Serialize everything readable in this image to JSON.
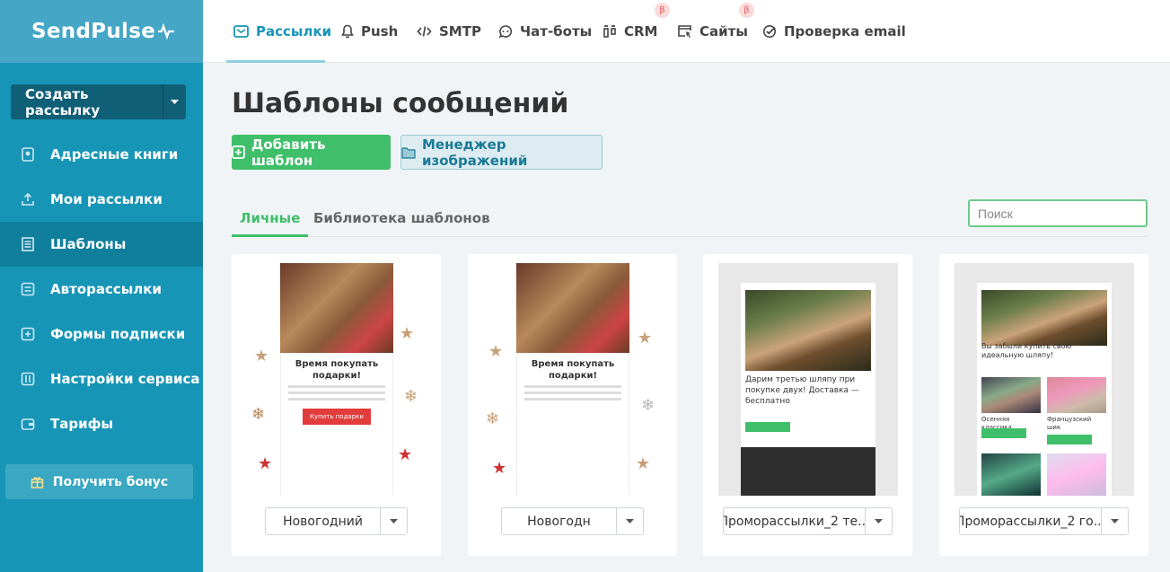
{
  "brand": {
    "name": "SendPulse"
  },
  "sidebar": {
    "create_label": "Создать рассылку",
    "items": [
      {
        "label": "Адресные книги",
        "icon": "address-book-icon"
      },
      {
        "label": "Мои рассылки",
        "icon": "upload-icon"
      },
      {
        "label": "Шаблоны",
        "icon": "template-icon"
      },
      {
        "label": "Авторассылки",
        "icon": "automation-icon"
      },
      {
        "label": "Формы подписки",
        "icon": "form-icon"
      },
      {
        "label": "Настройки сервиса",
        "icon": "settings-icon"
      },
      {
        "label": "Тарифы",
        "icon": "wallet-icon"
      }
    ],
    "active_index": 2,
    "bonus_label": "Получить бонус"
  },
  "topnav": {
    "items": [
      {
        "label": "Рассылки",
        "icon": "mail-icon",
        "active": true
      },
      {
        "label": "Push",
        "icon": "bell-icon"
      },
      {
        "label": "SMTP",
        "icon": "code-icon"
      },
      {
        "label": "Чат-боты",
        "icon": "chat-icon"
      },
      {
        "label": "CRM",
        "icon": "crm-icon",
        "beta": "β"
      },
      {
        "label": "Сайты",
        "icon": "site-icon",
        "beta": "β"
      },
      {
        "label": "Проверка email",
        "icon": "check-icon"
      }
    ]
  },
  "page": {
    "title": "Шаблоны сообщений",
    "add_template": "Добавить шаблон",
    "image_manager": "Менеджер изображений",
    "tabs": [
      "Личные",
      "Библиотека шаблонов"
    ],
    "search_placeholder": "Поиск"
  },
  "templates": [
    {
      "name": "Новогодний",
      "heading": "Время покупать подарки!",
      "button": "Купить подарки"
    },
    {
      "name": "Новогодн",
      "heading": "Время покупать подарки!"
    },
    {
      "name": "Проморассылки_2 те...",
      "heading": "Дарим третью шляпу при покупке двух! Доставка — бесплатно"
    },
    {
      "name": "Проморассылки_2 го...",
      "heading": "Вы забыли купить свою идеальную шляпу!",
      "sub1": "Осенняя классика",
      "sub2": "Французский шик"
    }
  ],
  "colors": {
    "sidebar": "#1795b6",
    "accent_green": "#3fbf6a",
    "active_nav": "#0f7f9c"
  }
}
